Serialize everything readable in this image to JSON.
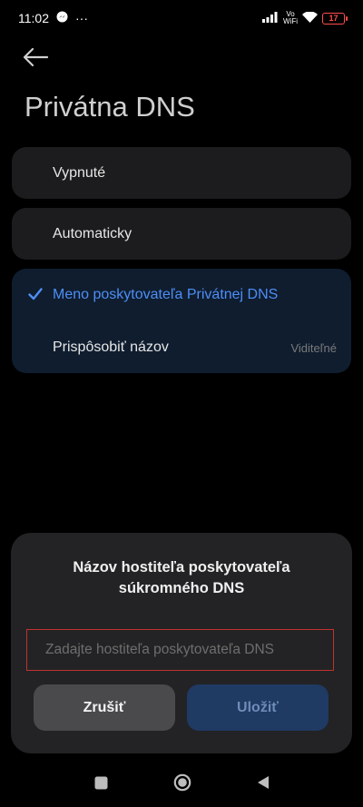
{
  "status_bar": {
    "time": "11:02",
    "more": "···",
    "volte_top": "Vo",
    "volte_bottom": "WiFi",
    "battery": "17",
    "battery_color": "#ff4d4d"
  },
  "header": {
    "back_icon": "arrow-left-icon",
    "title": "Privátna DNS"
  },
  "options": {
    "off_label": "Vypnuté",
    "auto_label": "Automaticky",
    "provider_label": "Meno poskytovateľa Privátnej DNS",
    "customize_label": "Prispôsobiť názov",
    "customize_value": "Viditeľné",
    "selected_color": "#4e8ef5"
  },
  "dialog": {
    "title": "Názov hostiteľa poskytovateľa súkromného DNS",
    "input_placeholder": "Zadajte hostiteľa poskytovateľa DNS",
    "input_value": "",
    "cancel_label": "Zrušiť",
    "save_label": "Uložiť"
  },
  "nav": {
    "recents_icon": "square-icon",
    "home_icon": "circle-icon",
    "back_icon": "triangle-back-icon"
  }
}
